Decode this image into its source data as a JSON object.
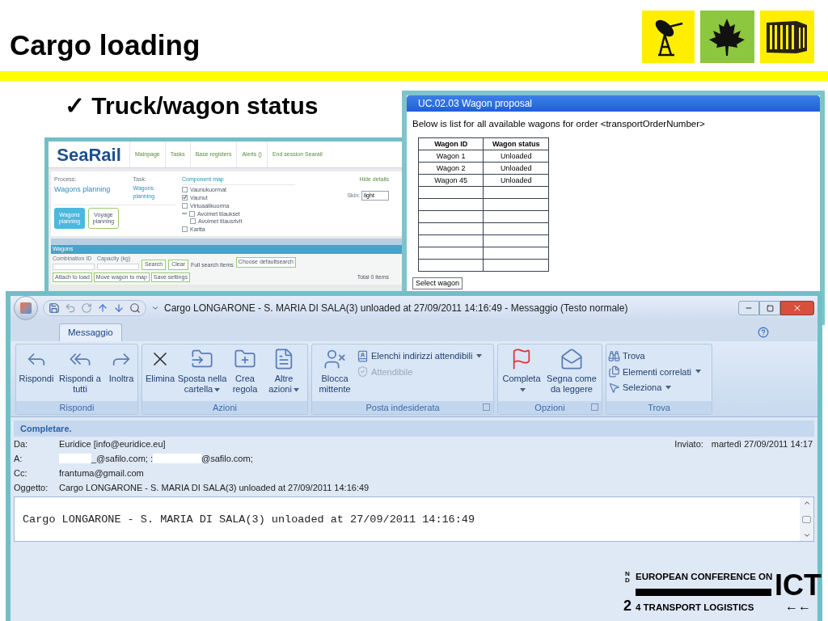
{
  "slide": {
    "title": "Cargo loading",
    "subtitle": "✓ Truck/wagon status"
  },
  "searail": {
    "logo": "SeaRail",
    "nav": [
      "Mainpage",
      "Tasks",
      "Base registers",
      "Alerts ()",
      "End session Searail"
    ],
    "process_label": "Process:",
    "process": "Wagons planning",
    "task_label": "Task:",
    "task": "Wagons planning",
    "component_map": "Component map",
    "tree": [
      {
        "label": "Vaunukuormat",
        "checked": false
      },
      {
        "label": "Vaunut",
        "checked": true
      },
      {
        "label": "Virtuaalikuorma",
        "checked": false
      },
      {
        "label": "Avoimet tilaukset",
        "checked": false,
        "expanded": true,
        "children": [
          {
            "label": "Avoimet tilausrivit",
            "checked": false
          }
        ]
      },
      {
        "label": "Kartta",
        "checked": false
      }
    ],
    "hide_details": "Hide details",
    "skin_label": "Skin:",
    "skin": "light",
    "process_buttons": [
      {
        "label": "Wagons planning",
        "selected": true
      },
      {
        "label": "Voyage planning",
        "selected": false
      }
    ],
    "panel_title": "Wagons",
    "fields": [
      {
        "label": "Combination ID"
      },
      {
        "label": "Capacity (kg)"
      }
    ],
    "search_buttons": [
      "Search",
      "Clear"
    ],
    "full_search": "Full search items",
    "choose_default": "Choose defaultsearch",
    "actions": [
      "Attach to load",
      "Move wagon to map",
      "Save settings"
    ],
    "total": "Total 0 items"
  },
  "proposal": {
    "title": "UC.02.03 Wagon proposal",
    "intro": "Below is list for all available wagons for order <transportOrderNumber>",
    "columns": [
      "Wagon ID",
      "Wagon status"
    ],
    "rows": [
      [
        "Wagon 1",
        "Unloaded"
      ],
      [
        "Wagon 2",
        "Unloaded"
      ],
      [
        "Wagon 45",
        "Unloaded"
      ]
    ],
    "button": "Select wagon"
  },
  "email": {
    "title": "Cargo LONGARONE - S. MARIA DI SALA(3) unloaded at 27/09/2011 14:16:49 - Messaggio (Testo normale)",
    "tabs": [
      {
        "label": "Messaggio",
        "selected": true
      }
    ],
    "groups": [
      {
        "name": "Rispondi",
        "launcher": false,
        "items": [
          {
            "kind": "large",
            "label": "Rispondi",
            "menu": false
          },
          {
            "kind": "large",
            "label": "Rispondi a tutti",
            "menu": false
          },
          {
            "kind": "large",
            "label": "Inoltra",
            "menu": false
          }
        ]
      },
      {
        "name": "Azioni",
        "launcher": false,
        "items": [
          {
            "kind": "large",
            "label": "Elimina",
            "menu": false
          },
          {
            "kind": "large",
            "label": "Sposta nella cartella",
            "menu": true
          },
          {
            "kind": "large",
            "label": "Crea regola",
            "menu": false
          },
          {
            "kind": "large",
            "label": "Altre azioni",
            "menu": true
          }
        ]
      },
      {
        "name": "Posta indesiderata",
        "launcher": true,
        "items": [
          {
            "kind": "large",
            "label": "Blocca mittente",
            "menu": false
          },
          {
            "kind": "small",
            "label": "Elenchi indirizzi attendibili",
            "menu": true,
            "disabled": false
          },
          {
            "kind": "small",
            "label": "Attendibile",
            "menu": false,
            "disabled": true
          }
        ]
      },
      {
        "name": "Opzioni",
        "launcher": true,
        "items": [
          {
            "kind": "large",
            "label": "Completa",
            "menu": true
          },
          {
            "kind": "large",
            "label": "Segna come da leggere",
            "menu": false
          }
        ]
      },
      {
        "name": "Trova",
        "launcher": false,
        "items": [
          {
            "kind": "small",
            "label": "Trova",
            "menu": false,
            "disabled": false
          },
          {
            "kind": "small",
            "label": "Elementi correlati",
            "menu": true,
            "disabled": false
          },
          {
            "kind": "small",
            "label": "Seleziona",
            "menu": true,
            "disabled": false
          }
        ]
      }
    ],
    "infobar": "Completare.",
    "from": {
      "label": "Da:",
      "value": "Euridice [info@euridice.eu]"
    },
    "sent": {
      "label": "Inviato:",
      "value": "martedì 27/09/2011 14:17"
    },
    "to": {
      "label": "A:",
      "parts": [
        "_@safilo.com; :",
        "@safilo.com;"
      ]
    },
    "cc": {
      "label": "Cc:",
      "value": "frantuma@gmail.com"
    },
    "subject": {
      "label": "Oggetto:",
      "value": "Cargo LONGARONE - S. MARIA DI SALA(3) unloaded at 27/09/2011 14:16:49"
    },
    "body": "Cargo LONGARONE - S. MARIA DI SALA(3) unloaded at 27/09/2011 14:16:49"
  },
  "conference": {
    "line1": "EUROPEAN CONFERENCE ON",
    "acronym": "ICT",
    "ordinal": "2",
    "ordinal_suffix": "ND",
    "line2": "4 TRANSPORT LOGISTICS",
    "arrows": "←←"
  }
}
